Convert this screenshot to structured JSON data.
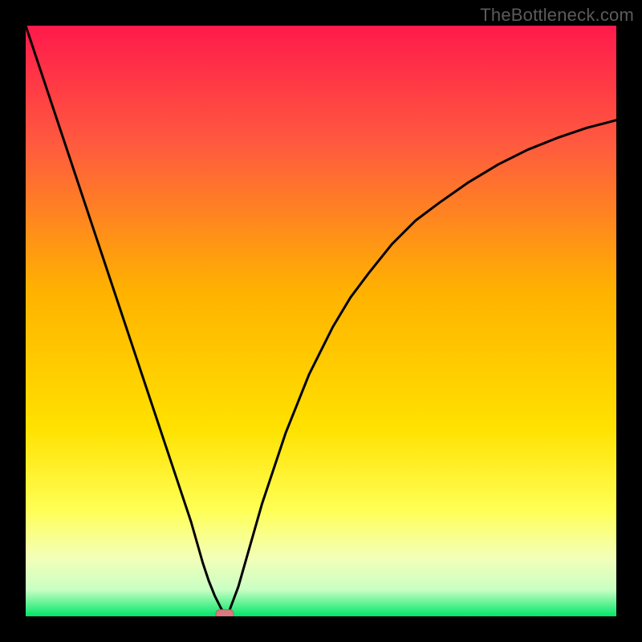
{
  "watermark": "TheBottleneck.com",
  "colors": {
    "frame": "#000000",
    "gradient_top": "#ff1a4b",
    "gradient_mid1": "#ff7a3a",
    "gradient_mid2": "#ffd400",
    "gradient_low": "#ffff66",
    "gradient_pale": "#f6ffd2",
    "gradient_bottom": "#00e674",
    "curve": "#000000",
    "marker_fill": "#d77b7e",
    "marker_stroke": "#b75f62"
  },
  "chart_data": {
    "type": "line",
    "title": "",
    "xlabel": "",
    "ylabel": "",
    "xlim": [
      0,
      100
    ],
    "ylim": [
      0,
      100
    ],
    "series": [
      {
        "name": "bottleneck-curve",
        "x": [
          0,
          2,
          4,
          6,
          8,
          10,
          12,
          14,
          16,
          18,
          20,
          22,
          24,
          26,
          28,
          30,
          31,
          32,
          33,
          33.7,
          34.5,
          36,
          38,
          40,
          42,
          44,
          46,
          48,
          50,
          52,
          55,
          58,
          62,
          66,
          70,
          75,
          80,
          85,
          90,
          95,
          100
        ],
        "y": [
          100,
          94,
          88,
          82,
          76,
          70,
          64,
          58,
          52,
          46,
          40,
          34,
          28,
          22,
          16,
          9,
          6,
          3.5,
          1.5,
          0.3,
          1,
          5,
          12,
          19,
          25,
          31,
          36,
          41,
          45,
          49,
          54,
          58,
          63,
          67,
          70,
          73.5,
          76.5,
          79,
          81,
          82.7,
          84
        ]
      }
    ],
    "marker": {
      "x": 33.7,
      "y": 0.3,
      "shape": "rounded-rect"
    },
    "gradient_stops": [
      {
        "pos": 0.0,
        "color": "#ff1a4b"
      },
      {
        "pos": 0.2,
        "color": "#ff5a3f"
      },
      {
        "pos": 0.45,
        "color": "#ffb200"
      },
      {
        "pos": 0.68,
        "color": "#ffe100"
      },
      {
        "pos": 0.82,
        "color": "#ffff55"
      },
      {
        "pos": 0.9,
        "color": "#f3ffb8"
      },
      {
        "pos": 0.955,
        "color": "#c9ffc4"
      },
      {
        "pos": 1.0,
        "color": "#00e668"
      }
    ]
  }
}
